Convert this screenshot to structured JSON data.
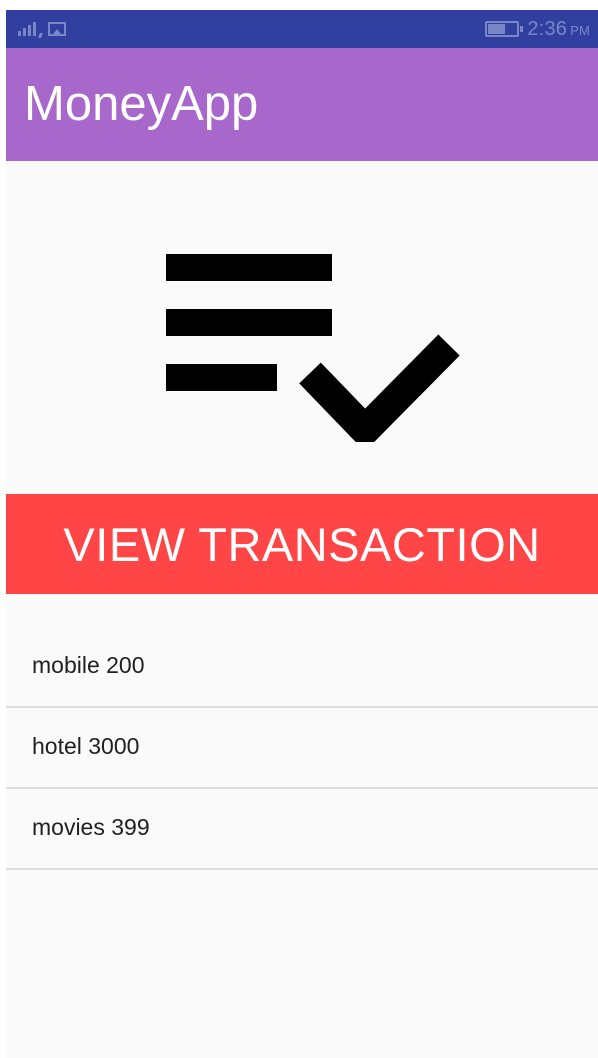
{
  "status_bar": {
    "time": "2:36",
    "ampm": "PM",
    "colors": {
      "background": "#3140a0",
      "icons": "#7b86c6"
    },
    "icons": [
      "signal-icon",
      "gallery-icon",
      "battery-icon"
    ]
  },
  "app_bar": {
    "title": "MoneyApp",
    "color": "#a767cb"
  },
  "hero": {
    "icon": "playlist-check-icon"
  },
  "main": {
    "view_button_label": "VIEW TRANSACTION",
    "view_button_color": "#ff4545"
  },
  "transactions": [
    {
      "label": "mobile 200"
    },
    {
      "label": "hotel 3000"
    },
    {
      "label": "movies 399"
    }
  ]
}
